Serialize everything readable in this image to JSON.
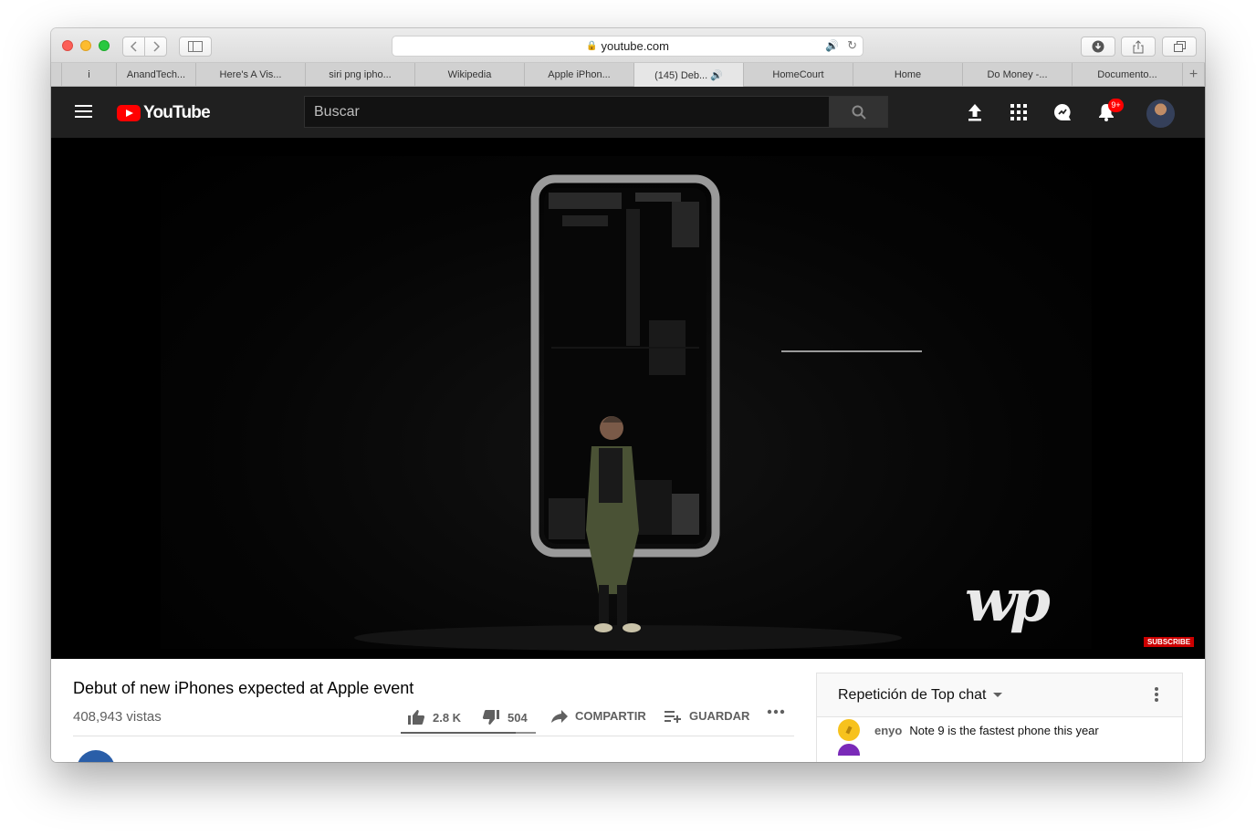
{
  "browser": {
    "url": "youtube.com",
    "tabs": [
      {
        "label": "i"
      },
      {
        "label": "AnandTech..."
      },
      {
        "label": "Here's A Vis..."
      },
      {
        "label": "siri png ipho..."
      },
      {
        "label": "Wikipedia"
      },
      {
        "label": "Apple iPhon..."
      },
      {
        "label": "(145) Deb... 🔊",
        "active": true
      },
      {
        "label": "HomeCourt"
      },
      {
        "label": "Home"
      },
      {
        "label": "Do Money -..."
      },
      {
        "label": "Documento..."
      }
    ],
    "new_tab_label": "+"
  },
  "youtube": {
    "wordmark": "YouTube",
    "search_placeholder": "Buscar",
    "notification_count": "9+"
  },
  "video": {
    "title": "Debut of new iPhones expected at Apple event",
    "views": "408,943 vistas",
    "watermark": "wp",
    "subscribe_label": "SUBSCRIBE",
    "like_ratio": 0.85
  },
  "actions": {
    "likes": "2.8 K",
    "dislikes": "504",
    "share": "COMPARTIR",
    "save": "GUARDAR"
  },
  "chat": {
    "title": "Repetición de Top chat",
    "messages": [
      {
        "author": "enyo",
        "text": "Note 9 is the fastest phone this year"
      }
    ]
  },
  "colors": {
    "youtube_red": "#ff0000",
    "header_bg": "#202020",
    "address_audio": "#1a7ae8"
  }
}
